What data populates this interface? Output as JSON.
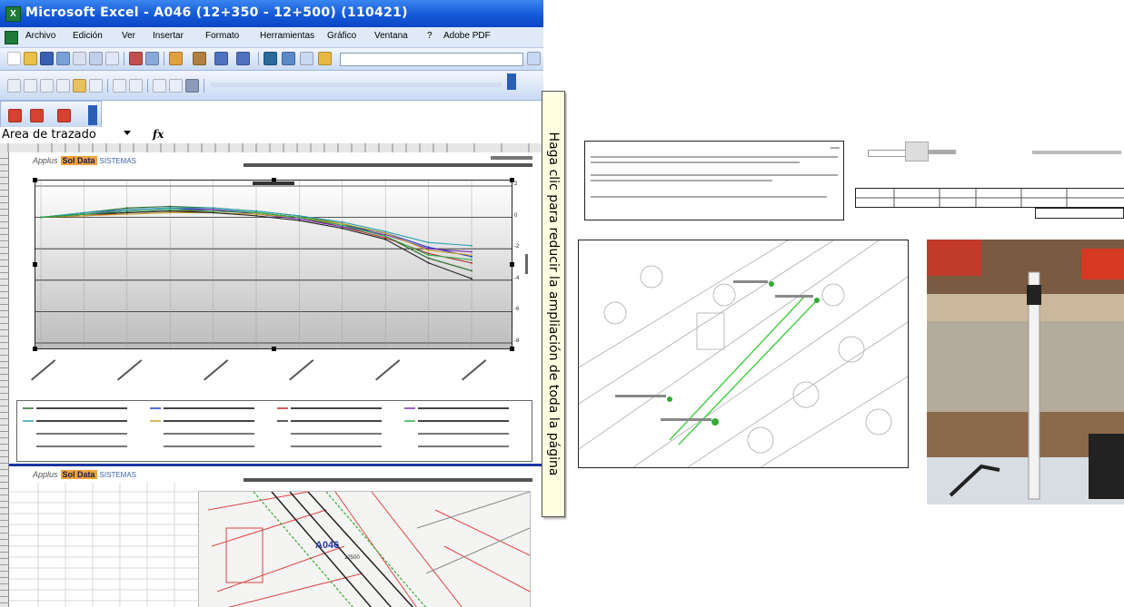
{
  "window": {
    "title": "Microsoft Excel - A046 (12+350 - 12+500) (110421)",
    "app_icon": "X"
  },
  "menu": [
    "Archivo",
    "Edición",
    "Ver",
    "Insertar",
    "Formato",
    "Herramientas",
    "Gráfico",
    "Ventana",
    "?",
    "Adobe PDF"
  ],
  "formula_bar": {
    "name_box": "Area de trazado",
    "fx": "fx"
  },
  "sheet": {
    "logo_brand": "Applus",
    "logo_product": "Sol Data",
    "logo_sub": "SISTEMAS"
  },
  "map": {
    "label": "A046"
  },
  "tooltip": {
    "text": "Haga clic para reducir la ampliación de toda la página"
  },
  "chart_data": {
    "type": "line",
    "series": [
      {
        "color": "#2a6a2a",
        "values": [
          0,
          0.3,
          0.6,
          0.7,
          0.6,
          0.4,
          0.1,
          -0.4,
          -1.2,
          -2.6,
          -3.4
        ]
      },
      {
        "color": "#1e3cc8",
        "values": [
          0,
          0.2,
          0.4,
          0.5,
          0.5,
          0.3,
          0.0,
          -0.5,
          -1.0,
          -1.9,
          -2.5
        ]
      },
      {
        "color": "#b02a2a",
        "values": [
          0,
          0.1,
          0.3,
          0.4,
          0.4,
          0.3,
          0.0,
          -0.6,
          -1.3,
          -2.3,
          -2.9
        ]
      },
      {
        "color": "#7a2ab0",
        "values": [
          0,
          0.2,
          0.5,
          0.6,
          0.5,
          0.2,
          -0.1,
          -0.6,
          -1.1,
          -2.0,
          -2.2
        ]
      },
      {
        "color": "#2aa0b0",
        "values": [
          0,
          0.3,
          0.5,
          0.6,
          0.6,
          0.4,
          0.1,
          -0.3,
          -0.9,
          -1.6,
          -1.8
        ]
      },
      {
        "color": "#c8a02a",
        "values": [
          0,
          0.1,
          0.2,
          0.3,
          0.3,
          0.2,
          0.0,
          -0.4,
          -1.0,
          -2.1,
          -2.4
        ]
      },
      {
        "color": "#222222",
        "values": [
          0,
          0.2,
          0.3,
          0.4,
          0.3,
          0.1,
          -0.2,
          -0.7,
          -1.4,
          -2.9,
          -3.9
        ]
      },
      {
        "color": "#2ab04a",
        "values": [
          0,
          0.2,
          0.4,
          0.5,
          0.4,
          0.3,
          0.0,
          -0.5,
          -1.2,
          -2.4,
          -2.7
        ]
      }
    ],
    "x_count": 11,
    "ylim": [
      -8,
      2
    ],
    "y_ticks": [
      2,
      0,
      -2,
      -4,
      -6,
      -8
    ],
    "grid": true,
    "legend": "bottom"
  }
}
